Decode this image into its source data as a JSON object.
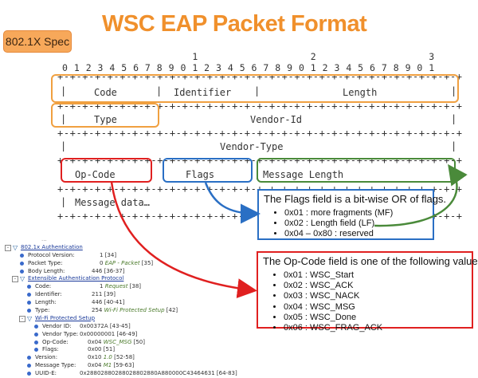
{
  "title": "WSC EAP Packet Format",
  "spec_label": "802.1X Spec",
  "bit_ruler": {
    "tens": "                      1                   2                   3",
    "units": "0 1 2 3 4 5 6 7 8 9 0 1 2 3 4 5 6 7 8 9 0 1 2 3 4 5 6 7 8 9 0 1"
  },
  "separator": "+-+-+-+-+-+-+-+-+-+-+-+-+-+-+-+-+-+-+-+-+-+-+-+-+-+-+-+-+-+-+-+-+",
  "fields": {
    "code": "Code",
    "identifier": "Identifier",
    "length": "Length",
    "type": "Type",
    "vendor_id": "Vendor-Id",
    "vendor_type": "Vendor-Type",
    "op_code": "Op-Code",
    "flags": "Flags",
    "message_length": "Message Length",
    "message_data": "Message data…"
  },
  "flags_callout": {
    "heading": "The Flags field is a bit-wise OR of flags.",
    "items": [
      "0x01 : more fragments (MF)",
      "0x02 : Length field (LF)",
      "0x04 – 0x80 : reserved"
    ]
  },
  "opcode_callout": {
    "heading": "The Op-Code field is one of the following values:",
    "items": [
      "0x01 : WSC_Start",
      "0x02 : WSC_ACK",
      "0x03 : WSC_NACK",
      "0x04 : WSC_MSG",
      "0x05 : WSC_Done",
      "0x06 : WSC_FRAG_ACK"
    ]
  },
  "capture": {
    "top_partial": "...",
    "rows": [
      {
        "indent": 0,
        "toggle": "-",
        "key": "802.1x Authentication",
        "link": true,
        "value": ""
      },
      {
        "indent": 1,
        "key": "Protocol Version:",
        "value": "1",
        "extra": "[34]"
      },
      {
        "indent": 1,
        "key": "Packet Type:",
        "value": "0",
        "italic": "EAP - Packet",
        "extra": "[35]"
      },
      {
        "indent": 1,
        "key": "Body Length:",
        "value": "446",
        "extra": "[36-37]"
      },
      {
        "indent": 1,
        "toggle": "-",
        "key": "Extensible Authentication Protocol",
        "link": true,
        "value": ""
      },
      {
        "indent": 2,
        "key": "Code:",
        "value": "1",
        "italic": "Request",
        "extra": "[38]"
      },
      {
        "indent": 2,
        "key": "Identifier:",
        "value": "211",
        "extra": "[39]"
      },
      {
        "indent": 2,
        "key": "Length:",
        "value": "446",
        "extra": "[40-41]"
      },
      {
        "indent": 2,
        "key": "Type:",
        "value": "254",
        "italic": "Wi-Fi Protected Setup",
        "extra": "[42]"
      },
      {
        "indent": 2,
        "toggle": "-",
        "key": "Wi-Fi Protected Setup",
        "link": true,
        "value": ""
      },
      {
        "indent": 3,
        "key": "Vendor ID:",
        "value": "0x00372A",
        "extra": "[43-45]"
      },
      {
        "indent": 3,
        "key": "Vendor Type:",
        "value": "0x00000001",
        "extra": "[46-49]"
      },
      {
        "indent": 3,
        "key": "Op-Code:",
        "value": "0x04",
        "italic": "WSC_MSG",
        "extra": "[50]"
      },
      {
        "indent": 3,
        "key": "Flags:",
        "value": "0x00",
        "extra": "[51]"
      },
      {
        "indent": 2,
        "key": "Version:",
        "value": "0x10",
        "italic": "1.0",
        "extra": "[52-58]"
      },
      {
        "indent": 2,
        "key": "Message Type:",
        "value": "0x04",
        "italic": "M1",
        "extra": "[59-63]"
      },
      {
        "indent": 2,
        "key": "UUID-E:",
        "value": "0x28802880288028802880A880000C43464631",
        "extra": "[64-83]"
      }
    ]
  },
  "colors": {
    "title": "#f0902c",
    "orange_box": "#f0a040",
    "red": "#e02020",
    "blue": "#2a6fc4",
    "green": "#4a8a3a"
  }
}
